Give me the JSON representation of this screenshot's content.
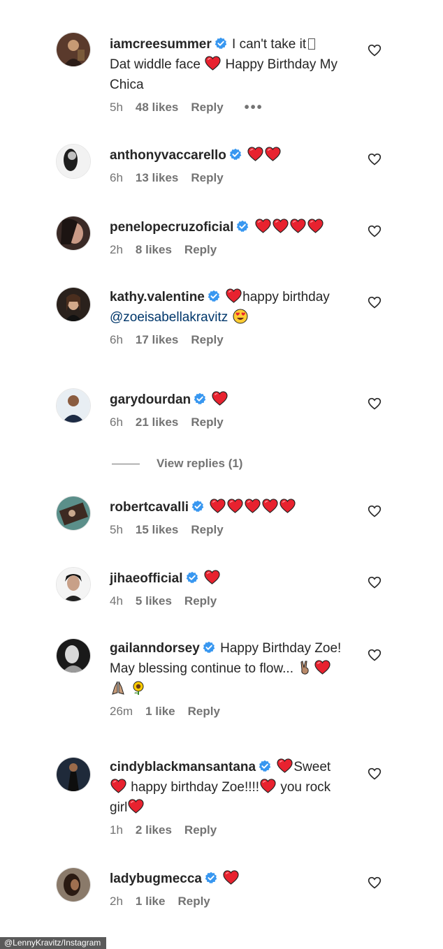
{
  "comments": [
    {
      "username": "iamcreesummer",
      "before": "I can't take it",
      "line2": "Dat widdle face",
      "after": "Happy Birthday My Chica",
      "time": "5h",
      "likes": "48 likes",
      "reply": "Reply"
    },
    {
      "username": "anthonyvaccarello",
      "time": "6h",
      "likes": "13 likes",
      "reply": "Reply"
    },
    {
      "username": "penelopecruzoficial",
      "time": "2h",
      "likes": "8 likes",
      "reply": "Reply"
    },
    {
      "username": "kathy.valentine",
      "text1": "happy birthday",
      "mention": "@zoeisabellakravitz",
      "time": "6h",
      "likes": "17 likes",
      "reply": "Reply"
    },
    {
      "username": "garydourdan",
      "time": "6h",
      "likes": "21 likes",
      "reply": "Reply"
    },
    {
      "username": "robertcavalli",
      "time": "5h",
      "likes": "15 likes",
      "reply": "Reply"
    },
    {
      "username": "jihaeofficial",
      "time": "4h",
      "likes": "5 likes",
      "reply": "Reply"
    },
    {
      "username": "gailanndorsey",
      "text1": "Happy Birthday Zoe! May blessing continue to flow...",
      "time": "26m",
      "likes": "1 like",
      "reply": "Reply"
    },
    {
      "username": "cindyblackmansantana",
      "text1": "Sweet",
      "text2": "happy birthday Zoe!!!!",
      "text3": "you rock girl",
      "time": "1h",
      "likes": "2 likes",
      "reply": "Reply"
    },
    {
      "username": "ladybugmecca",
      "time": "2h",
      "likes": "1 like",
      "reply": "Reply"
    }
  ],
  "view_replies": "View replies (1)",
  "credit": "@LennyKravitz/Instagram",
  "colors": {
    "heart": "#e8222f",
    "verified": "#3897f0",
    "meta": "#737373"
  }
}
